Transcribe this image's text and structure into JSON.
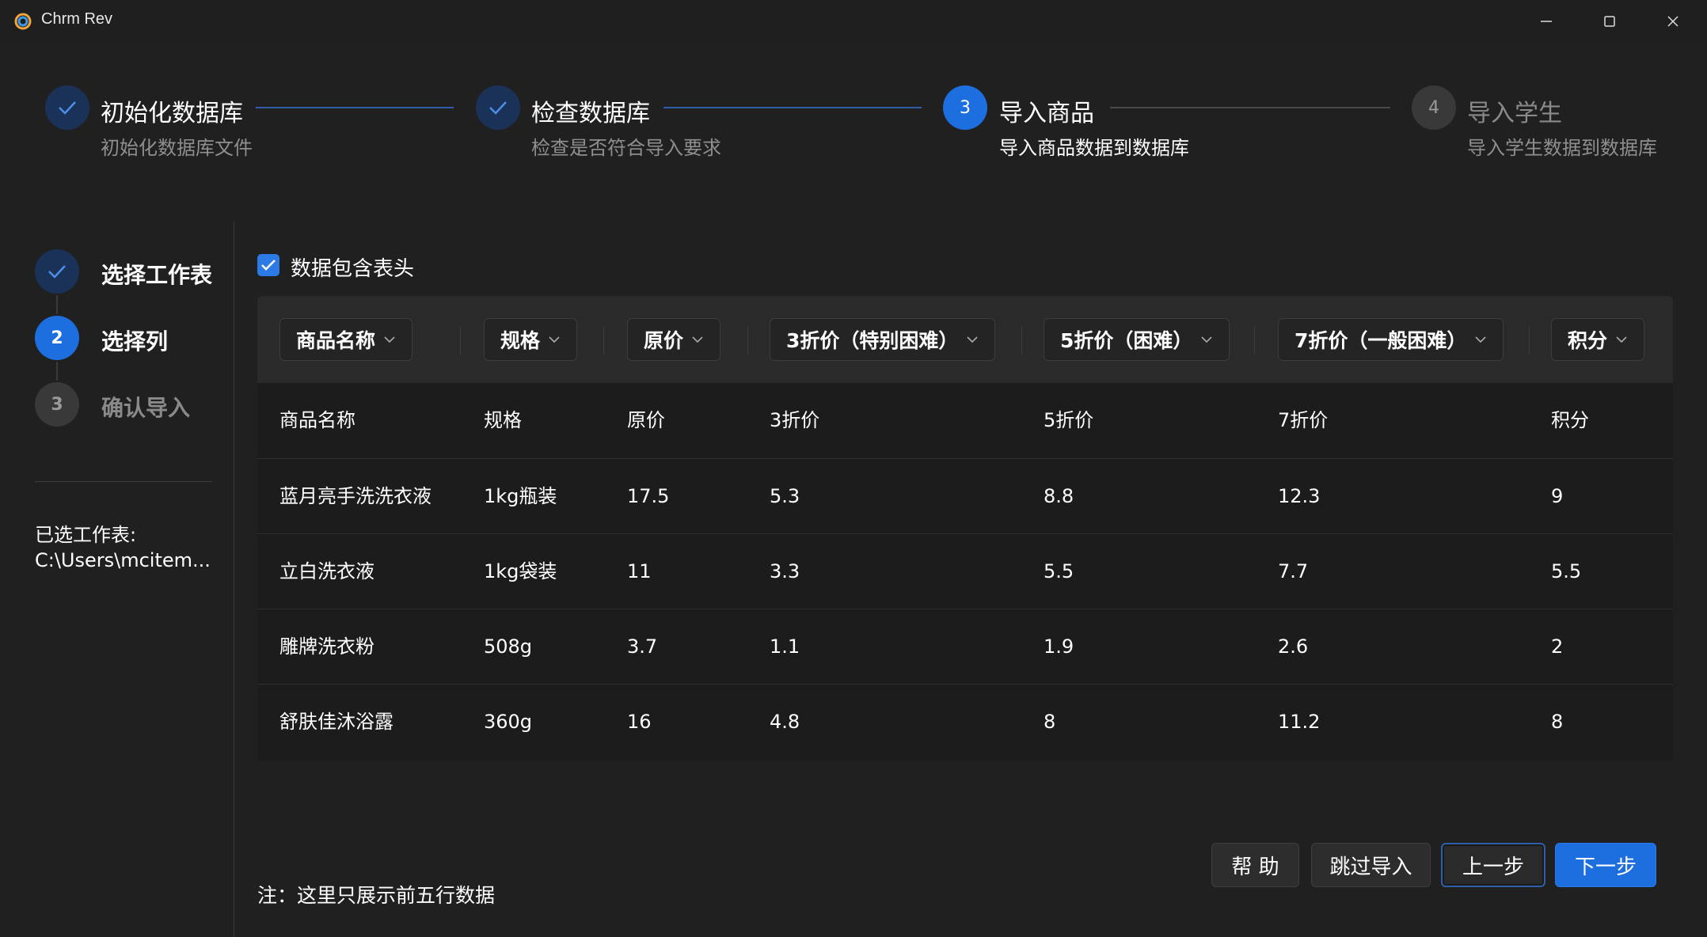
{
  "window": {
    "title": "Chrm Rev"
  },
  "stepper": [
    {
      "title": "初始化数据库",
      "desc": "初始化数据库文件",
      "state": "done"
    },
    {
      "title": "检查数据库",
      "desc": "检查是否符合导入要求",
      "state": "done"
    },
    {
      "number": "3",
      "title": "导入商品",
      "desc": "导入商品数据到数据库",
      "state": "active"
    },
    {
      "number": "4",
      "title": "导入学生",
      "desc": "导入学生数据到数据库",
      "state": "todo"
    }
  ],
  "substeps": [
    {
      "label": "选择工作表",
      "state": "done"
    },
    {
      "number": "2",
      "label": "选择列",
      "state": "active"
    },
    {
      "number": "3",
      "label": "确认导入",
      "state": "todo"
    }
  ],
  "selected_sheet": {
    "label": "已选工作表:",
    "path": "C:\\Users\\mcitem..."
  },
  "header_checkbox": {
    "label": "数据包含表头",
    "checked": true
  },
  "column_mapping": [
    "商品名称",
    "规格",
    "原价",
    "3折价（特别困难）",
    "5折价（困难）",
    "7折价（一般困难）",
    "积分"
  ],
  "table": {
    "headers": [
      "商品名称",
      "规格",
      "原价",
      "3折价",
      "5折价",
      "7折价",
      "积分"
    ],
    "rows": [
      [
        "蓝月亮手洗洗衣液",
        "1kg瓶装",
        "17.5",
        "5.3",
        "8.8",
        "12.3",
        "9"
      ],
      [
        "立白洗衣液",
        "1kg袋装",
        "11",
        "3.3",
        "5.5",
        "7.7",
        "5.5"
      ],
      [
        "雕牌洗衣粉",
        "508g",
        "3.7",
        "1.1",
        "1.9",
        "2.6",
        "2"
      ],
      [
        "舒肤佳沐浴露",
        "360g",
        "16",
        "4.8",
        "8",
        "11.2",
        "8"
      ]
    ]
  },
  "note": "注：这里只展示前五行数据",
  "buttons": {
    "help": "帮 助",
    "skip": "跳过导入",
    "prev": "上一步",
    "next": "下一步"
  },
  "colors": {
    "accent": "#1d6fe0",
    "done_circle": "#1a3257",
    "background": "#202020"
  }
}
